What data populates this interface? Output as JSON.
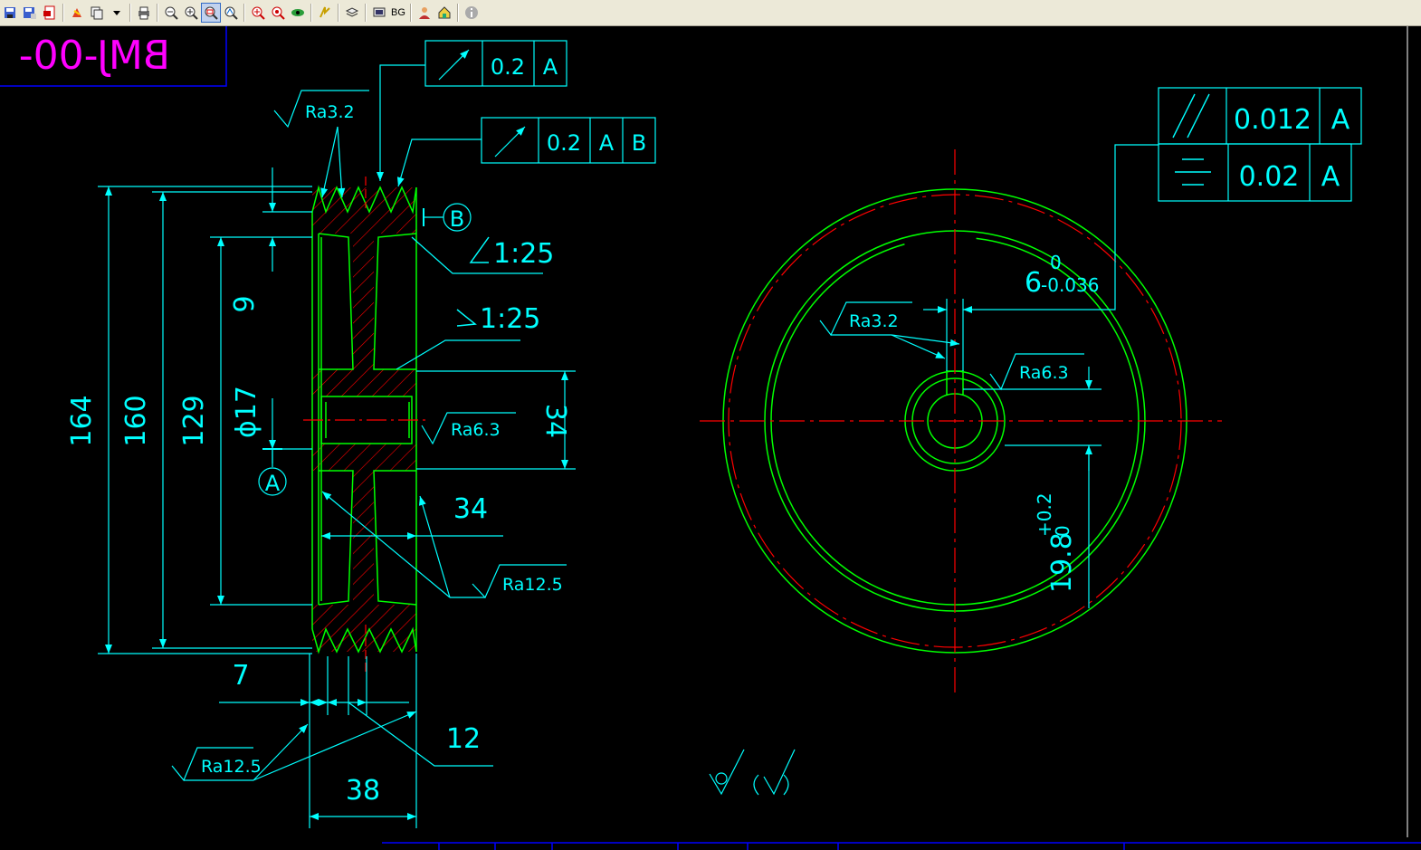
{
  "toolbar": {
    "buttons": [
      {
        "icon": "save-icon"
      },
      {
        "icon": "save-as-icon"
      },
      {
        "icon": "pdf-export-icon"
      },
      {
        "sep": true
      },
      {
        "icon": "pan-icon"
      },
      {
        "icon": "layout-icon"
      },
      {
        "icon": "dropdown-arrow-icon"
      },
      {
        "sep": true
      },
      {
        "icon": "print-icon"
      },
      {
        "sep": true
      },
      {
        "icon": "zoom-out-icon"
      },
      {
        "icon": "zoom-in-icon"
      },
      {
        "icon": "zoom-window-icon",
        "selected": true
      },
      {
        "icon": "zoom-realtime-icon"
      },
      {
        "sep": true
      },
      {
        "icon": "zoom-extents-icon"
      },
      {
        "icon": "zoom-all-icon"
      },
      {
        "icon": "view-eye-icon"
      },
      {
        "sep": true
      },
      {
        "icon": "regen-icon"
      },
      {
        "sep": true
      },
      {
        "icon": "layers-icon"
      },
      {
        "sep": true
      },
      {
        "icon": "monitor-icon"
      },
      {
        "text": "BG"
      },
      {
        "sep": true
      },
      {
        "icon": "user-icon"
      },
      {
        "icon": "home-icon"
      },
      {
        "sep": true
      },
      {
        "icon": "info-icon"
      }
    ]
  },
  "drawing": {
    "title_partial": "BMJ-00-",
    "gdt": {
      "runout1": {
        "value": "0.2",
        "datum": "A"
      },
      "runout2": {
        "value": "0.2",
        "datum1": "A",
        "datum2": "B"
      },
      "parallel": {
        "value": "0.012",
        "datum": "A"
      },
      "symmetry": {
        "value": "0.02",
        "datum": "A"
      }
    },
    "datums": {
      "a": "A",
      "b": "B"
    },
    "taper1": "1:25",
    "taper2": "1:25",
    "dims": {
      "d164": "164",
      "d160": "160",
      "d129": "129",
      "d9": "9",
      "d17": "ϕ17",
      "d34v": "34",
      "d34h": "34",
      "d7": "7",
      "d12": "12",
      "d38": "38",
      "keyway_nominal": "6",
      "keyway_upper": "0",
      "keyway_lower": "-0.036",
      "depth_nominal": "19.8",
      "depth_upper": "+0.2",
      "depth_lower": "0"
    },
    "roughness": {
      "r1": "Ra3.2",
      "r2": "Ra6.3",
      "r3": "Ra12.5",
      "r4": "Ra12.5",
      "r5": "Ra3.2",
      "r6": "Ra6.3"
    },
    "colors": {
      "cyan": "#00ffff",
      "green": "#00ff00",
      "red": "#ff0000",
      "magenta": "#ff00ff",
      "blue": "#0000ff",
      "bg": "#000000"
    }
  }
}
